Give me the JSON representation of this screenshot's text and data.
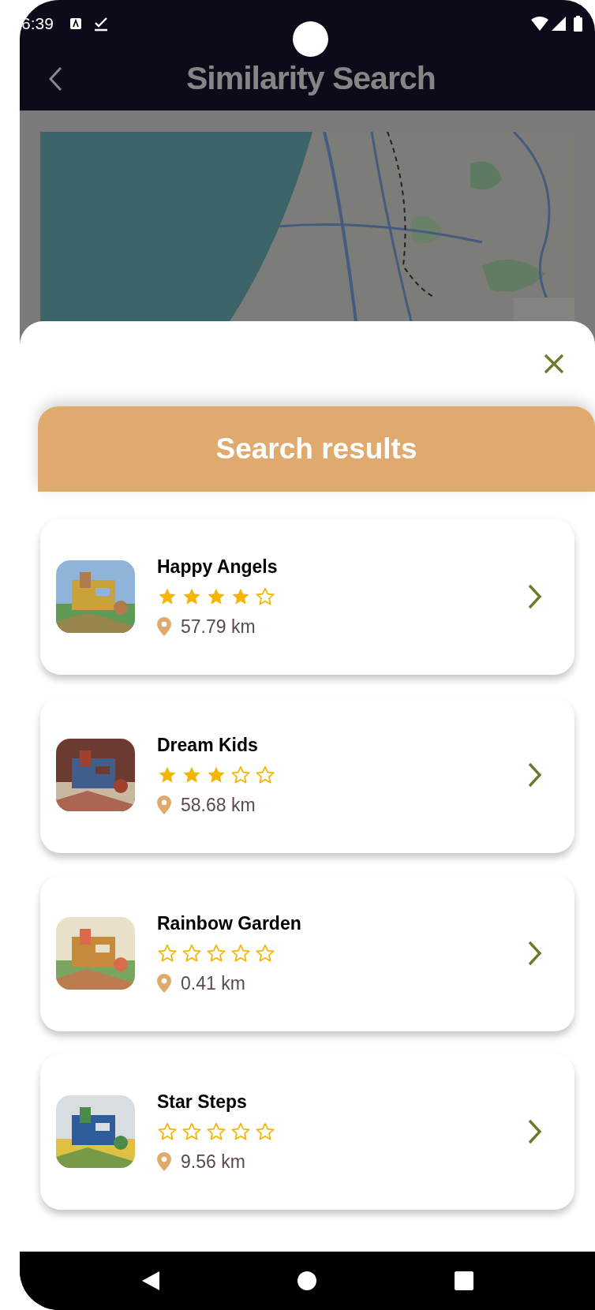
{
  "status_bar": {
    "time": "6:39"
  },
  "header": {
    "title": "Similarity Search"
  },
  "panel": {
    "title": "Search results"
  },
  "results": [
    {
      "name": "Happy Angels",
      "stars": 4,
      "distance": "57.79 km"
    },
    {
      "name": "Dream Kids",
      "stars": 3,
      "distance": "58.68 km"
    },
    {
      "name": "Rainbow Garden",
      "stars": 0,
      "distance": "0.41 km"
    },
    {
      "name": "Star Steps",
      "stars": 0,
      "distance": "9.56 km"
    }
  ]
}
